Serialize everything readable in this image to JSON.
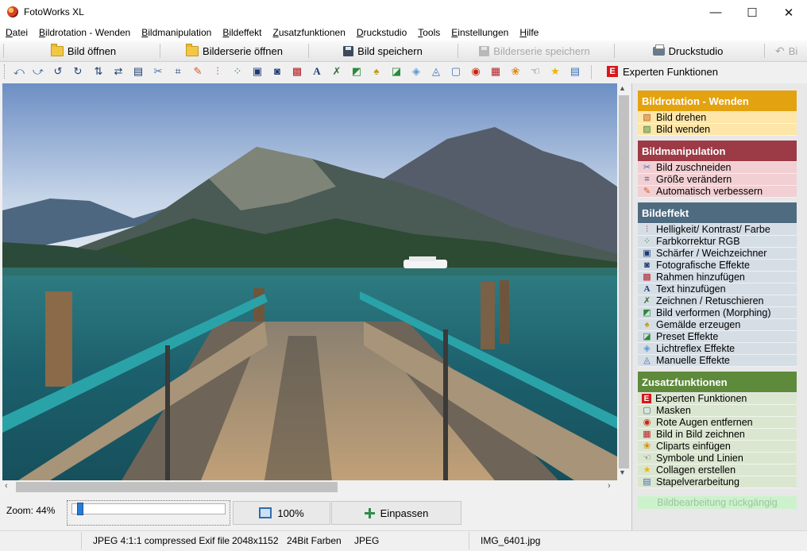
{
  "window": {
    "title": "FotoWorks XL",
    "minimize": "—",
    "maximize": "☐",
    "close": "✕"
  },
  "menu": [
    "Datei",
    "Bildrotation - Wenden",
    "Bildmanipulation",
    "Bildeffekt",
    "Zusatzfunktionen",
    "Druckstudio",
    "Tools",
    "Einstellungen",
    "Hilfe"
  ],
  "toolbar1": {
    "open_image": "Bild öffnen",
    "open_series": "Bilderserie öffnen",
    "save_image": "Bild speichern",
    "save_series": "Bilderserie speichern",
    "print_studio": "Druckstudio",
    "undo_partial": "Bi"
  },
  "toolbar2": {
    "icons": [
      "rotate-left-icon",
      "rotate-right-icon",
      "rotate-ccw-icon",
      "rotate-cw-icon",
      "flip-icon",
      "mirror-icon",
      "resize-icon",
      "cut-icon",
      "crop-icon",
      "wand-icon",
      "levels-icon",
      "color-dots-icon",
      "sharpen-icon",
      "photo-effect-icon",
      "frame-icon",
      "text-icon",
      "draw-icon",
      "morph-icon",
      "paint-icon",
      "preset-icon",
      "lens-flare-icon",
      "manual-effects-icon",
      "mask-icon",
      "red-eye-icon",
      "picture-in-picture-icon",
      "clipart-icon",
      "symbol-icon",
      "star-icon",
      "batch-icon"
    ],
    "expert_label": "Experten Funktionen",
    "expert_badge": "E"
  },
  "zoom": {
    "label": "Zoom: 44%",
    "level": 0.04,
    "btn_100": "100%",
    "btn_fit": "Einpassen"
  },
  "status": {
    "format": "JPEG 4:1:1 compressed Exif file",
    "dimensions": "2048x1152",
    "depth": "24Bit Farben",
    "type": "JPEG",
    "filename": "IMG_6401.jpg"
  },
  "sidepanel": {
    "sections": [
      {
        "title": "Bildrotation - Wenden",
        "color": "#e3a20f",
        "item_bg": "#fde6a8",
        "items": [
          {
            "label": "Bild drehen",
            "icon": "rotate-photo-icon"
          },
          {
            "label": "Bild wenden",
            "icon": "flip-photo-icon"
          }
        ]
      },
      {
        "title": "Bildmanipulation",
        "color": "#9c3a45",
        "item_bg": "#f1cfd3",
        "items": [
          {
            "label": "Bild zuschneiden",
            "icon": "scissors-icon"
          },
          {
            "label": "Größe verändern",
            "icon": "resize-icon"
          },
          {
            "label": "Automatisch verbessern",
            "icon": "magic-wand-icon"
          }
        ]
      },
      {
        "title": "Bildeffekt",
        "color": "#4e6b80",
        "item_bg": "#d5dde5",
        "items": [
          {
            "label": "Helligkeit/ Kontrast/ Farbe",
            "icon": "levels-icon"
          },
          {
            "label": "Farbkorrektur RGB",
            "icon": "rgb-icon"
          },
          {
            "label": "Schärfer / Weichzeichner",
            "icon": "sharpen-icon"
          },
          {
            "label": "Fotografische Effekte",
            "icon": "photo-effect-icon"
          },
          {
            "label": "Rahmen hinzufügen",
            "icon": "frame-icon"
          },
          {
            "label": "Text hinzufügen",
            "icon": "text-icon"
          },
          {
            "label": "Zeichnen / Retuschieren",
            "icon": "draw-icon"
          },
          {
            "label": "Bild verformen (Morphing)",
            "icon": "morph-icon"
          },
          {
            "label": "Gemälde erzeugen",
            "icon": "paint-icon"
          },
          {
            "label": "Preset Effekte",
            "icon": "preset-icon"
          },
          {
            "label": "Lichtreflex Effekte",
            "icon": "lens-flare-icon"
          },
          {
            "label": "Manuelle Effekte",
            "icon": "manual-effects-icon"
          }
        ]
      },
      {
        "title": "Zusatzfunktionen",
        "color": "#5e8a3b",
        "item_bg": "#dbe6d0",
        "items": [
          {
            "label": "Experten Funktionen",
            "icon": "expert-icon"
          },
          {
            "label": "Masken",
            "icon": "mask-icon"
          },
          {
            "label": "Rote Augen entfernen",
            "icon": "red-eye-icon"
          },
          {
            "label": "Bild in Bild zeichnen",
            "icon": "picture-in-picture-icon"
          },
          {
            "label": "Cliparts einfügen",
            "icon": "clipart-icon"
          },
          {
            "label": "Symbole und Linien",
            "icon": "symbol-icon"
          },
          {
            "label": "Collagen erstellen",
            "icon": "star-icon"
          },
          {
            "label": "Stapelverarbeitung",
            "icon": "batch-icon"
          }
        ]
      }
    ],
    "undo_label": "Bildbearbeitung rückgängig"
  }
}
